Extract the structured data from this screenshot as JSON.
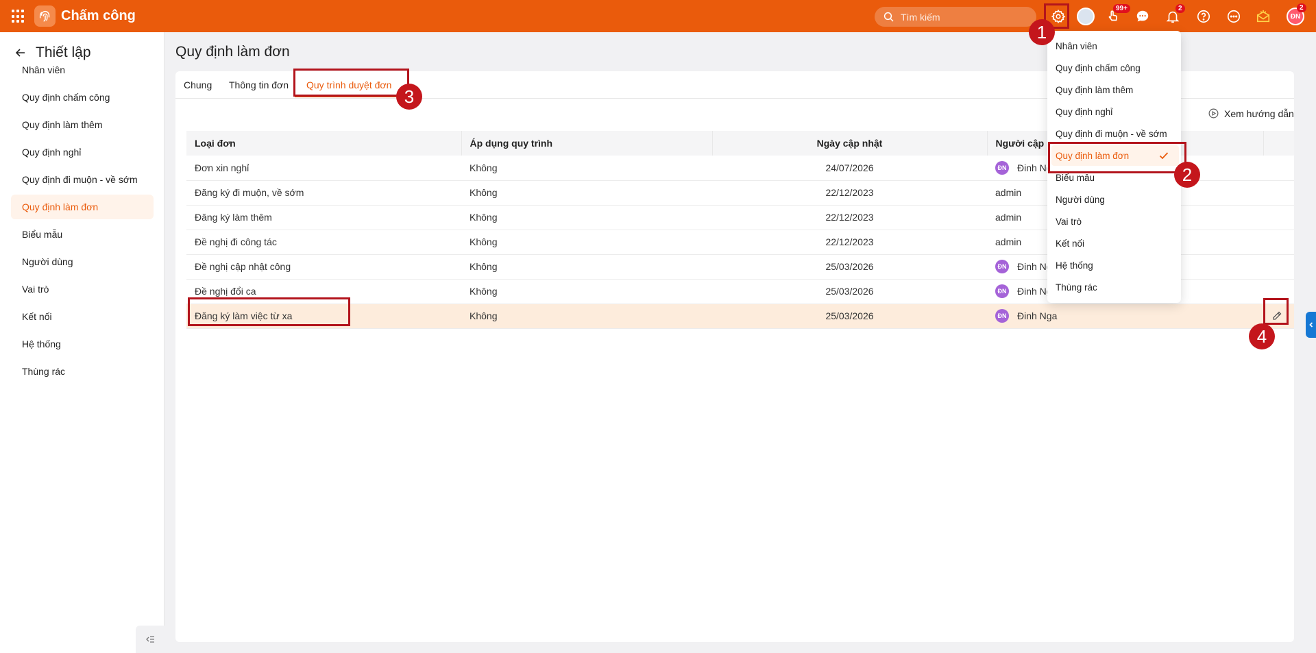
{
  "app": {
    "title": "Chấm công"
  },
  "search": {
    "placeholder": "Tìm kiếm"
  },
  "topbar": {
    "badges": {
      "activity": "99+",
      "notifications": "2",
      "avatar": "2"
    },
    "avatar_initials": "ĐN"
  },
  "sidebar": {
    "title": "Thiết lập",
    "items": [
      {
        "label": "Nhân viên"
      },
      {
        "label": "Quy định chấm công"
      },
      {
        "label": "Quy định làm thêm"
      },
      {
        "label": "Quy định nghỉ"
      },
      {
        "label": "Quy định đi muộn - về sớm"
      },
      {
        "label": "Quy định làm đơn",
        "active": true
      },
      {
        "label": "Biểu mẫu"
      },
      {
        "label": "Người dùng"
      },
      {
        "label": "Vai trò"
      },
      {
        "label": "Kết nối"
      },
      {
        "label": "Hệ thống"
      },
      {
        "label": "Thùng rác"
      }
    ]
  },
  "page": {
    "title": "Quy định làm đơn"
  },
  "tabs": [
    {
      "label": "Chung"
    },
    {
      "label": "Thông tin đơn"
    },
    {
      "label": "Quy trình duyệt đơn",
      "active": true
    }
  ],
  "guide_label": "Xem hướng dẫn",
  "table": {
    "headers": [
      "Loại đơn",
      "Áp dụng quy trình",
      "Ngày cập nhật",
      "Người cập nhật"
    ],
    "rows": [
      {
        "type": "Đơn xin nghỉ",
        "apply": "Không",
        "date": "24/07/2026",
        "user": "Đinh Nga",
        "avatar": "ĐN"
      },
      {
        "type": "Đăng ký đi muộn, về sớm",
        "apply": "Không",
        "date": "22/12/2023",
        "user": "admin",
        "avatar": ""
      },
      {
        "type": "Đăng ký làm thêm",
        "apply": "Không",
        "date": "22/12/2023",
        "user": "admin",
        "avatar": ""
      },
      {
        "type": "Đề nghị đi công tác",
        "apply": "Không",
        "date": "22/12/2023",
        "user": "admin",
        "avatar": ""
      },
      {
        "type": "Đề nghị cập nhật công",
        "apply": "Không",
        "date": "25/03/2026",
        "user": "Đinh Nga",
        "avatar": "ĐN"
      },
      {
        "type": "Đề nghị đổi ca",
        "apply": "Không",
        "date": "25/03/2026",
        "user": "Đinh Nga",
        "avatar": "ĐN"
      },
      {
        "type": "Đăng ký làm việc từ xa",
        "apply": "Không",
        "date": "25/03/2026",
        "user": "Đinh Nga",
        "avatar": "ĐN",
        "highlight": true
      }
    ]
  },
  "dropdown": {
    "items": [
      {
        "label": "Nhân viên"
      },
      {
        "label": "Quy định chấm công"
      },
      {
        "label": "Quy định làm thêm"
      },
      {
        "label": "Quy định nghỉ"
      },
      {
        "label": "Quy định đi muộn - về sớm"
      },
      {
        "label": "Quy định làm đơn",
        "active": true
      },
      {
        "label": "Biểu mẫu"
      },
      {
        "label": "Người dùng"
      },
      {
        "label": "Vai trò"
      },
      {
        "label": "Kết nối"
      },
      {
        "label": "Hệ thống"
      },
      {
        "label": "Thùng rác"
      }
    ]
  },
  "callouts": [
    "1",
    "2",
    "3",
    "4"
  ],
  "colors": {
    "brand": "#ea5b0c",
    "annotation": "#b3141c",
    "avatar": "#a563d8"
  }
}
